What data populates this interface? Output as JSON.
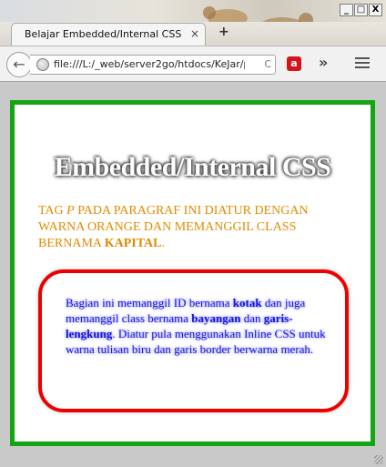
{
  "window": {
    "controls": {
      "minimize": "_",
      "maximize": "□",
      "close": "X"
    }
  },
  "tab": {
    "title": "Belajar Embedded/Internal CSS",
    "close": "×",
    "new_tab": "+"
  },
  "nav": {
    "back": "←",
    "url": "file:///L:/_web/server2go/htdocs/KeJar/p",
    "reload": "C",
    "avira": "a",
    "overflow": "»"
  },
  "page": {
    "heading": "Embedded/Internal CSS",
    "paragraph": {
      "part1": "TAG ",
      "tag": "P",
      "part2": " pada paragraf ini diatur dengan warna orange dan memanggil class bernama ",
      "classname": "KAPITAL",
      "end": "."
    },
    "box": {
      "t1": "Bagian ini memanggil ID bernama ",
      "id": "kotak",
      "t2": " dan juga memanggil class bernama ",
      "class1": "bayangan",
      "t3": " dan ",
      "class2": "garis-lengkung",
      "t4": ". Diatur pula menggunakan Inline CSS untuk warna tulisan biru dan garis border berwarna merah."
    }
  },
  "colors": {
    "outer_border": "#13a613",
    "paragraph": "#e18a00",
    "box_border": "#ee0000",
    "box_text": "#1515d8"
  }
}
